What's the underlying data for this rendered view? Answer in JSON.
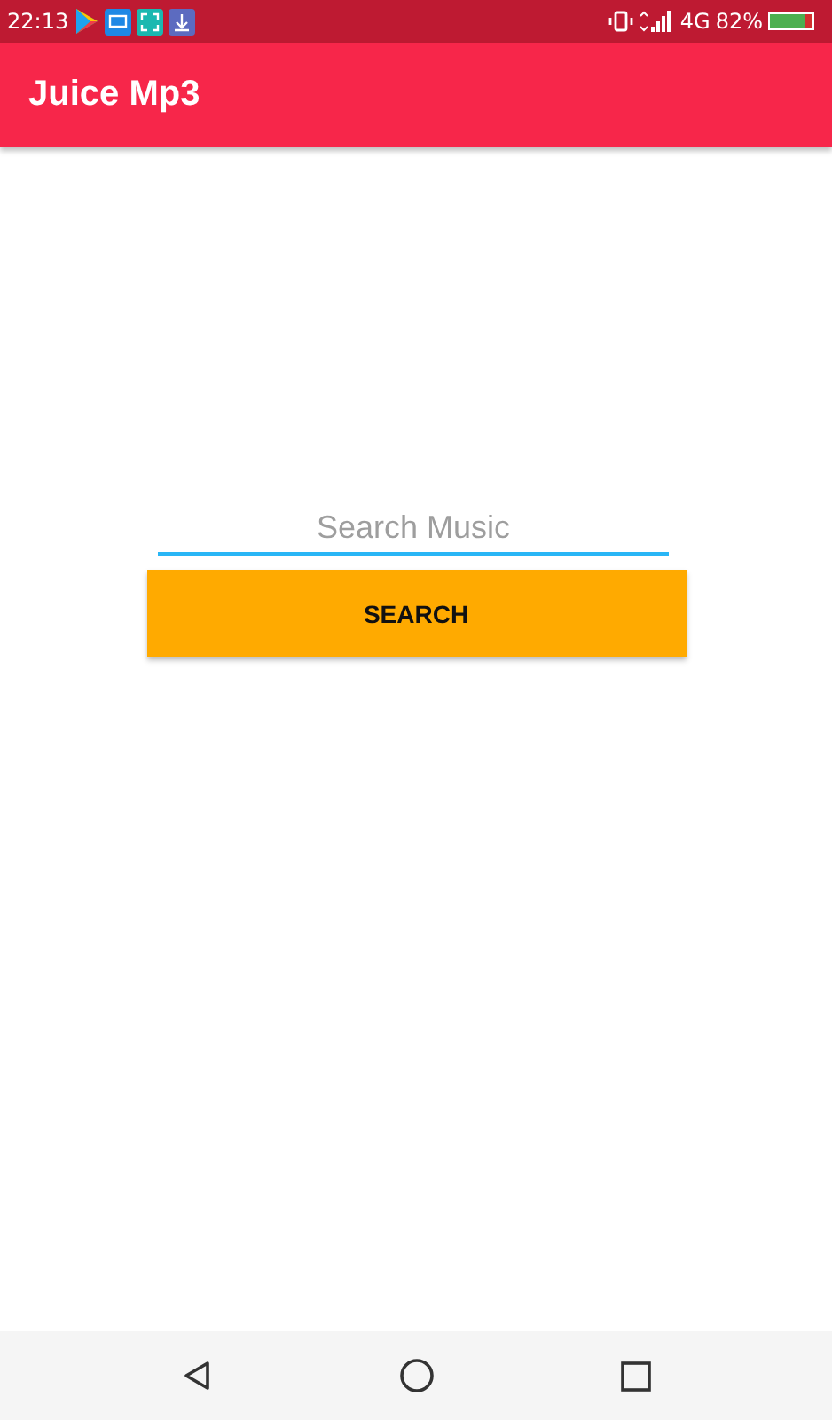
{
  "status_bar": {
    "time": "22:13",
    "network": "4G",
    "battery": "82%",
    "battery_icon": {
      "level": 0.82
    }
  },
  "app_bar": {
    "title": "Juice Mp3"
  },
  "search": {
    "placeholder": "Search Music"
  },
  "search_button": {
    "label": "SEARCH"
  }
}
